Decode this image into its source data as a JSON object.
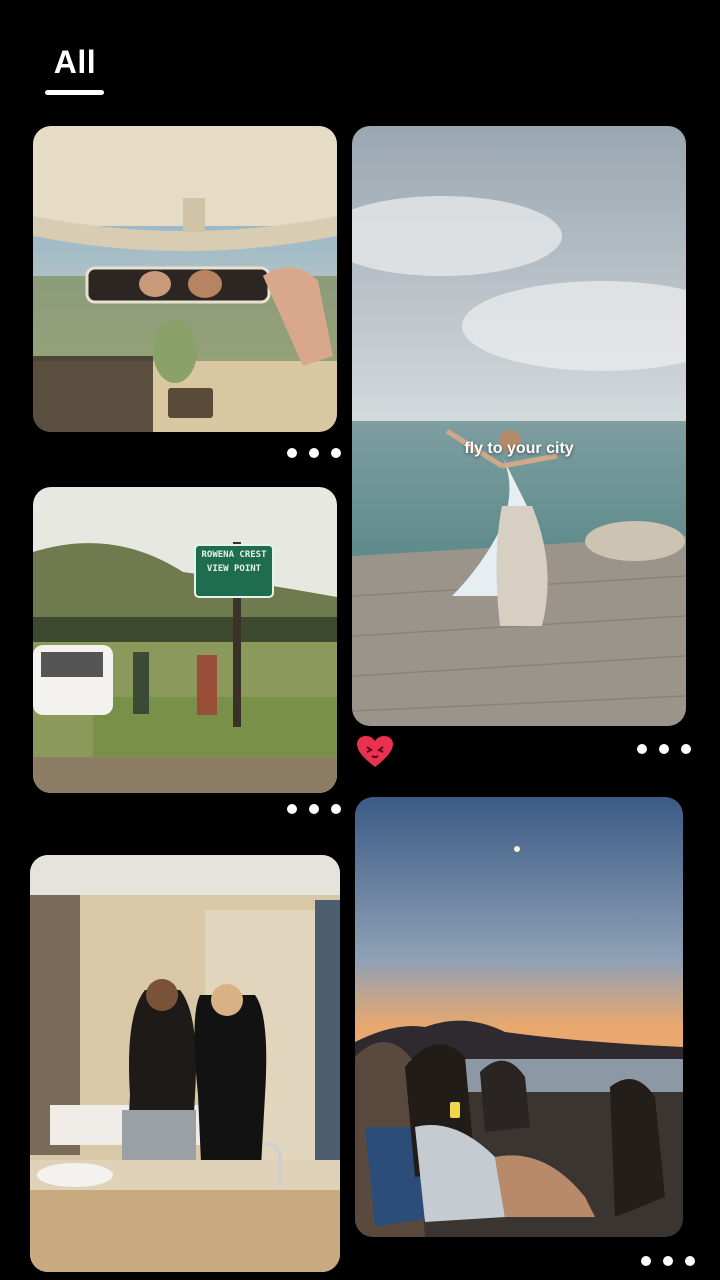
{
  "tabs": {
    "active": "All"
  },
  "pins": [
    {
      "id": "car-mirror",
      "overlay": ""
    },
    {
      "id": "ocean-dance",
      "overlay": "fly to your city"
    },
    {
      "id": "view-point",
      "sign_line1": "ROWENA CREST",
      "sign_line2": "VIEW POINT"
    },
    {
      "id": "bathroom-mirror",
      "overlay": ""
    },
    {
      "id": "beach-sunset",
      "overlay": ""
    }
  ],
  "icons": {
    "more": "more-horizontal-icon",
    "reaction": "heart-face-icon"
  },
  "colors": {
    "background": "#000000",
    "accent": "#e8324f",
    "text": "#ffffff"
  }
}
